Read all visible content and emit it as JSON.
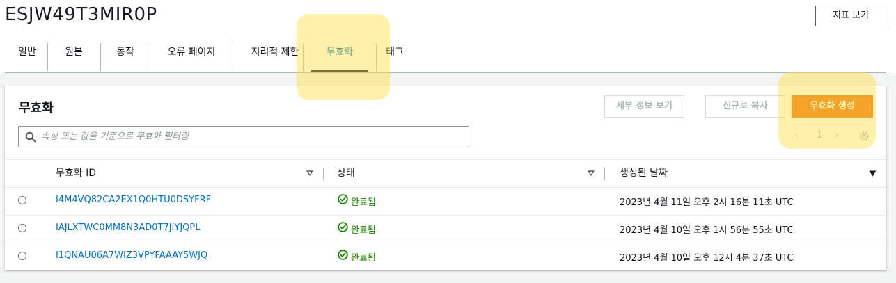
{
  "page": {
    "title": "ESJW49T3MIR0P",
    "metrics_button": "지표 보기"
  },
  "tabs": [
    {
      "label": "일반"
    },
    {
      "label": "원본"
    },
    {
      "label": "동작"
    },
    {
      "label": "오류 페이지"
    },
    {
      "label": "지리적 제한"
    },
    {
      "label": "무효화",
      "active": true
    },
    {
      "label": "태그"
    }
  ],
  "panel": {
    "title": "무효화",
    "buttons": {
      "details": "세부 정보 보기",
      "copy": "신규로 복사",
      "create": "무효화 생성"
    },
    "search": {
      "placeholder": "속성 또는 값을 기준으로 무효화 필터링",
      "icon": "search-icon"
    },
    "pagination": {
      "prev": "‹",
      "page": "1",
      "next": "›"
    },
    "columns": {
      "id": "무효화 ID",
      "status": "상태",
      "created": "생성된 날짜"
    },
    "rows": [
      {
        "id": "I4M4VQ82CA2EX1Q0HTU0DSYFRF",
        "status": "완료됨",
        "created": "2023년 4월 11일 오후 2시 16분 11초 UTC"
      },
      {
        "id": "IAJLXTWC0MM8N3AD0T7JIYJQPL",
        "status": "완료됨",
        "created": "2023년 4월 10일 오후 1시 56분 55초 UTC"
      },
      {
        "id": "I1QNAU06A7WIZ3VPYFAAAY5WJQ",
        "status": "완료됨",
        "created": "2023년 4월 10일 오후 12시 4분 37초 UTC"
      }
    ]
  },
  "colors": {
    "accent": "#0073bb",
    "primary": "#ec7211",
    "success": "#1d8102",
    "highlight": "#ffdf46"
  }
}
